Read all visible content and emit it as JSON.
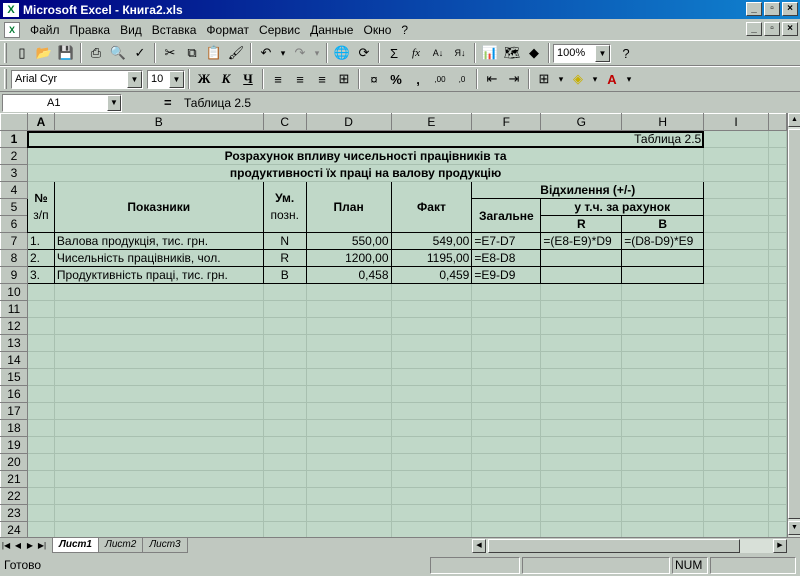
{
  "window": {
    "title": "Microsoft Excel - Книга2.xls",
    "app_icon": "excel-icon"
  },
  "menu": [
    "Файл",
    "Правка",
    "Вид",
    "Вставка",
    "Формат",
    "Сервис",
    "Данные",
    "Окно",
    "?"
  ],
  "toolbar": {
    "zoom": "100%",
    "font_name": "Arial Cyr",
    "font_size": "10",
    "bold": "Ж",
    "italic": "К",
    "underline": "Ч",
    "percent": "%",
    "comma": ",",
    "sum": "Σ",
    "fx": "fx"
  },
  "formula_bar": {
    "cell_ref": "A1",
    "eq": "=",
    "content": "Таблица 2.5"
  },
  "columns": [
    "A",
    "B",
    "C",
    "D",
    "E",
    "F",
    "G",
    "H",
    "I"
  ],
  "rows": [
    "1",
    "2",
    "3",
    "4",
    "5",
    "6",
    "7",
    "8",
    "9",
    "10",
    "11",
    "12",
    "13",
    "14",
    "15",
    "16",
    "17",
    "18",
    "19",
    "20",
    "21",
    "22",
    "23",
    "24"
  ],
  "cells": {
    "h1": "Таблица 2.5",
    "title1": "Розрахунок впливу чисельності працівників та",
    "title2": "продуктивності їх праці на валову продукцію",
    "hdr_no": "№",
    "hdr_no2": "з/п",
    "hdr_indicators": "Показники",
    "hdr_um": "Ум.",
    "hdr_um2": "позн.",
    "hdr_plan": "План",
    "hdr_fact": "Факт",
    "hdr_deviation": "Відхилення (+/-)",
    "hdr_total": "Загальне",
    "hdr_incl": "у т.ч. за рахунок",
    "hdr_r": "R",
    "hdr_b": "B",
    "rows": [
      {
        "no": "1.",
        "name": "Валова продукція, тис. грн.",
        "sym": "N",
        "plan": "550,00",
        "fact": "549,00",
        "total": "=E7-D7",
        "r": "=(E8-E9)*D9",
        "b": "=(D8-D9)*E9"
      },
      {
        "no": "2.",
        "name": "Чисельність працівників, чол.",
        "sym": "R",
        "plan": "1200,00",
        "fact": "1195,00",
        "total": "=E8-D8",
        "r": "",
        "b": ""
      },
      {
        "no": "3.",
        "name": "Продуктивність праці, тис. грн.",
        "sym": "В",
        "plan": "0,458",
        "fact": "0,459",
        "total": "=E9-D9",
        "r": "",
        "b": ""
      }
    ]
  },
  "sheets": [
    "Лист1",
    "Лист2",
    "Лист3"
  ],
  "status": {
    "ready": "Готово",
    "num": "NUM"
  }
}
